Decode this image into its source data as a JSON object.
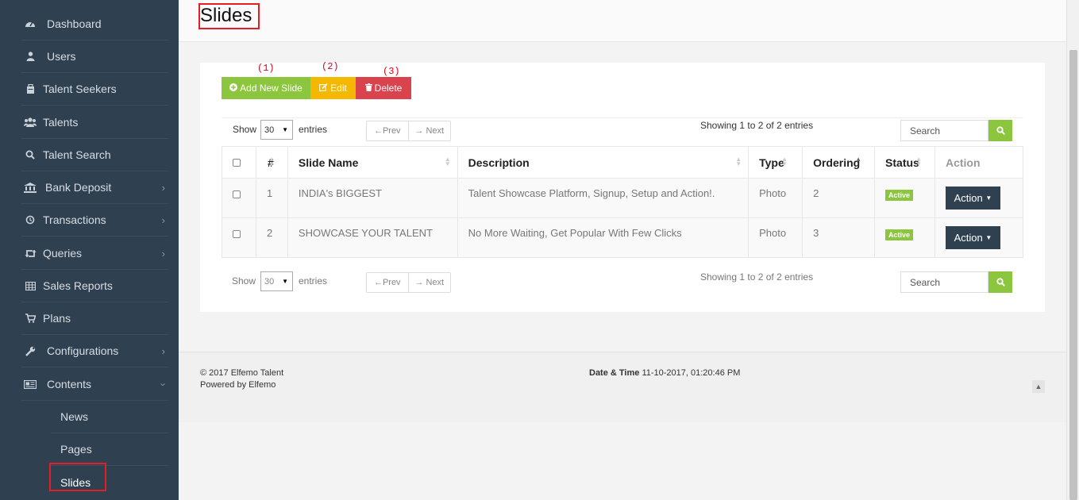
{
  "sidebar": {
    "items": [
      {
        "label": "Dashboard",
        "icon": "dashboard-icon"
      },
      {
        "label": "Users",
        "icon": "user-icon"
      },
      {
        "label": "Talent Seekers",
        "icon": "briefcase-icon"
      },
      {
        "label": "Talents",
        "icon": "users-icon"
      },
      {
        "label": "Talent Search",
        "icon": "search-icon"
      },
      {
        "label": "Bank Deposit",
        "icon": "bank-icon"
      },
      {
        "label": "Transactions",
        "icon": "history-icon"
      },
      {
        "label": "Queries",
        "icon": "retweet-icon"
      },
      {
        "label": "Sales Reports",
        "icon": "table-icon"
      },
      {
        "label": "Plans",
        "icon": "cart-icon"
      },
      {
        "label": "Configurations",
        "icon": "wrench-icon"
      },
      {
        "label": "Contents",
        "icon": "newspaper-icon"
      }
    ],
    "sub_items": [
      "News",
      "Pages",
      "Slides"
    ]
  },
  "header": {
    "title": "Slides"
  },
  "toolbar": {
    "add_label": "Add New Slide",
    "edit_label": "Edit",
    "delete_label": "Delete",
    "annot_1": "(1)",
    "annot_2": "(2)",
    "annot_3": "(3)"
  },
  "table_controls": {
    "show_label": "Show",
    "entries_label": "entries",
    "page_size": "30",
    "prev_label": "←Prev",
    "next_label": "→ Next",
    "info": "Showing 1 to 2 of 2 entries",
    "search_placeholder": "Search"
  },
  "table": {
    "headers": [
      "#",
      "Slide Name",
      "Description",
      "Type",
      "Ordering",
      "Status",
      "Action"
    ],
    "rows": [
      {
        "num": "1",
        "name": "INDIA's BIGGEST",
        "description": "Talent Showcase Platform, Signup, Setup and Action!.",
        "type": "Photo",
        "ordering": "2",
        "status": "Active",
        "action": "Action"
      },
      {
        "num": "2",
        "name": "SHOWCASE YOUR TALENT",
        "description": "No More Waiting, Get Popular With Few Clicks",
        "type": "Photo",
        "ordering": "3",
        "status": "Active",
        "action": "Action"
      }
    ]
  },
  "footer": {
    "copyright": "© 2017 Elfemo Talent",
    "powered": "Powered by Elfemo",
    "date_label": "Date & Time",
    "date_value": "11-10-2017, 01:20:46 PM"
  },
  "colors": {
    "sidebar_bg": "#2f4050",
    "add_button": "#8cc63e",
    "edit_button": "#f5b800",
    "delete_button": "#d9434e",
    "highlight": "#e31e24",
    "active_badge": "#8cc63e"
  }
}
